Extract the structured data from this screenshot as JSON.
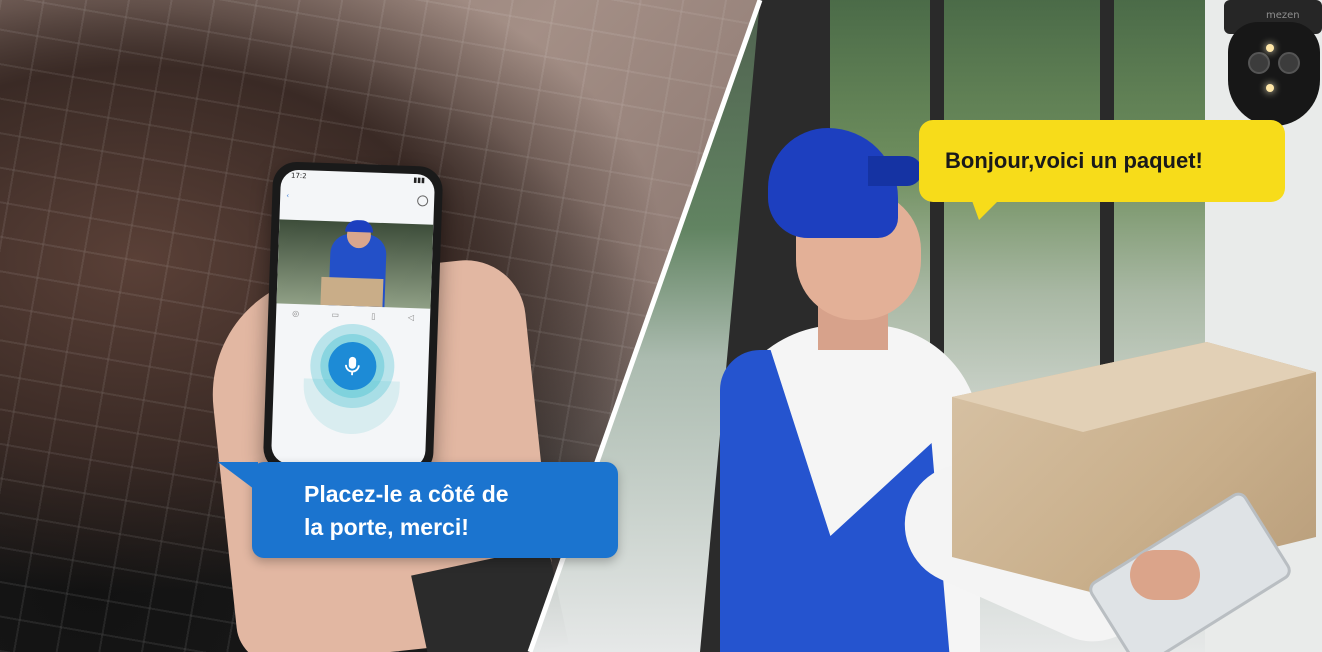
{
  "left_bubble": {
    "line1": "Placez-le a côté de",
    "line2": "la porte, merci!",
    "color": "#1b74cf"
  },
  "right_bubble": {
    "text": "Bonjour,voici un paquet!",
    "color": "#f7dc1a"
  },
  "camera": {
    "brand": "mezen"
  },
  "phone": {
    "time": "17:2",
    "icons": [
      "back-icon",
      "settings-icon",
      "microphone-icon"
    ]
  }
}
